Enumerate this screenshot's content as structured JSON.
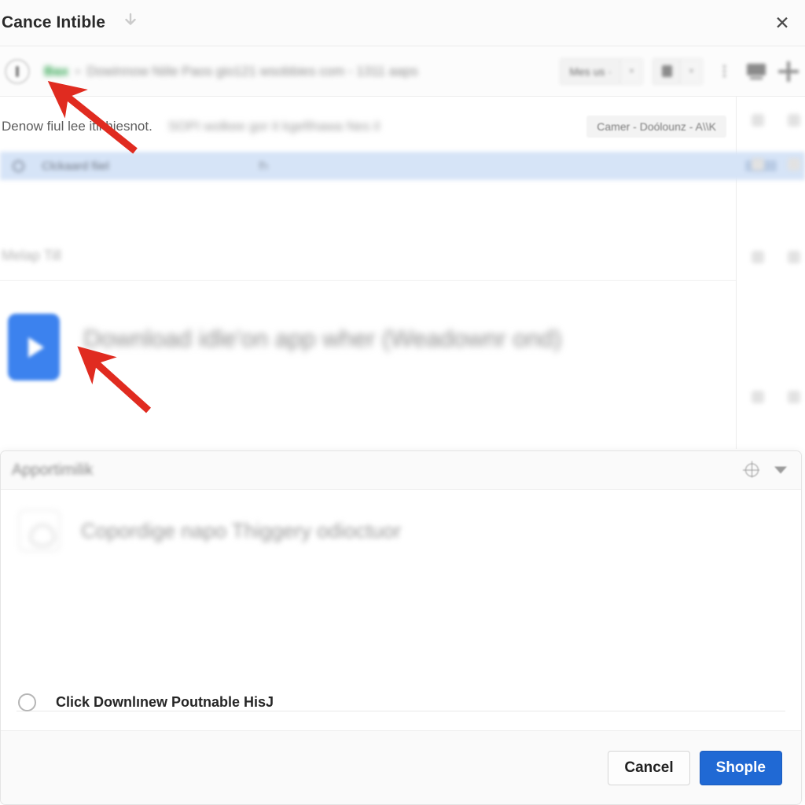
{
  "window": {
    "title": "Cance Intible",
    "download_icon": "download-arrow-icon",
    "close_label": "✕"
  },
  "omnibox": {
    "security_icon": "info-circle-icon",
    "secure_label": "Bax",
    "separator": "•",
    "url_text": "Dowinnow Niile Paos gio121 wsobbies com - 1311 aaps",
    "toolbar": {
      "account_chip": "Mes us ·",
      "account_chip_arrow": "▾",
      "delete_icon": "trash-icon",
      "delete_arrow": "▾",
      "overflow_icon": "kebab-menu-icon",
      "cast_icon": "screen-cast-icon",
      "add_icon": "plus-icon"
    }
  },
  "content": {
    "note_text": "Denow fiul lee itii hiesnot.",
    "note_blurred": "SOPI  wolkee gor it   kgefihawa Nes il",
    "note_chip": "Camer - Doólounz - A\\\\K",
    "selected_row": {
      "icon": "record-circle-icon",
      "label": "Clckaard fiiel",
      "middle": "fh",
      "trailing": ""
    },
    "section_label": "Melap Till",
    "media": {
      "play_icon": "play-button-icon",
      "title": "Download idle'on app wher (Weadownr ond)"
    }
  },
  "dialog": {
    "header_title": "Apportimilik",
    "header_target_icon": "target-crosshair-icon",
    "header_caret_icon": "caret-down-icon",
    "drive": {
      "icon": "cloud-drive-icon",
      "label": "Copordige napo Thiggery odioctuor"
    },
    "radio": {
      "icon": "radio-unselected-icon",
      "label": "Click Downlınew Poutnable HisJ",
      "selected": false
    },
    "footer": {
      "cancel_label": "Cancel",
      "confirm_label": "Shople"
    }
  },
  "annotations": {
    "arrow_color": "#e02b20",
    "arrow_1": "pointer-arrow-to-omnibox",
    "arrow_2": "pointer-arrow-to-play-tile"
  },
  "colors": {
    "primary_blue": "#2069d4",
    "play_tile_blue": "#3c82ee",
    "selected_row_blue": "#d6e4f7",
    "secure_green": "#2aa34a",
    "arrow_red": "#e02b20"
  }
}
